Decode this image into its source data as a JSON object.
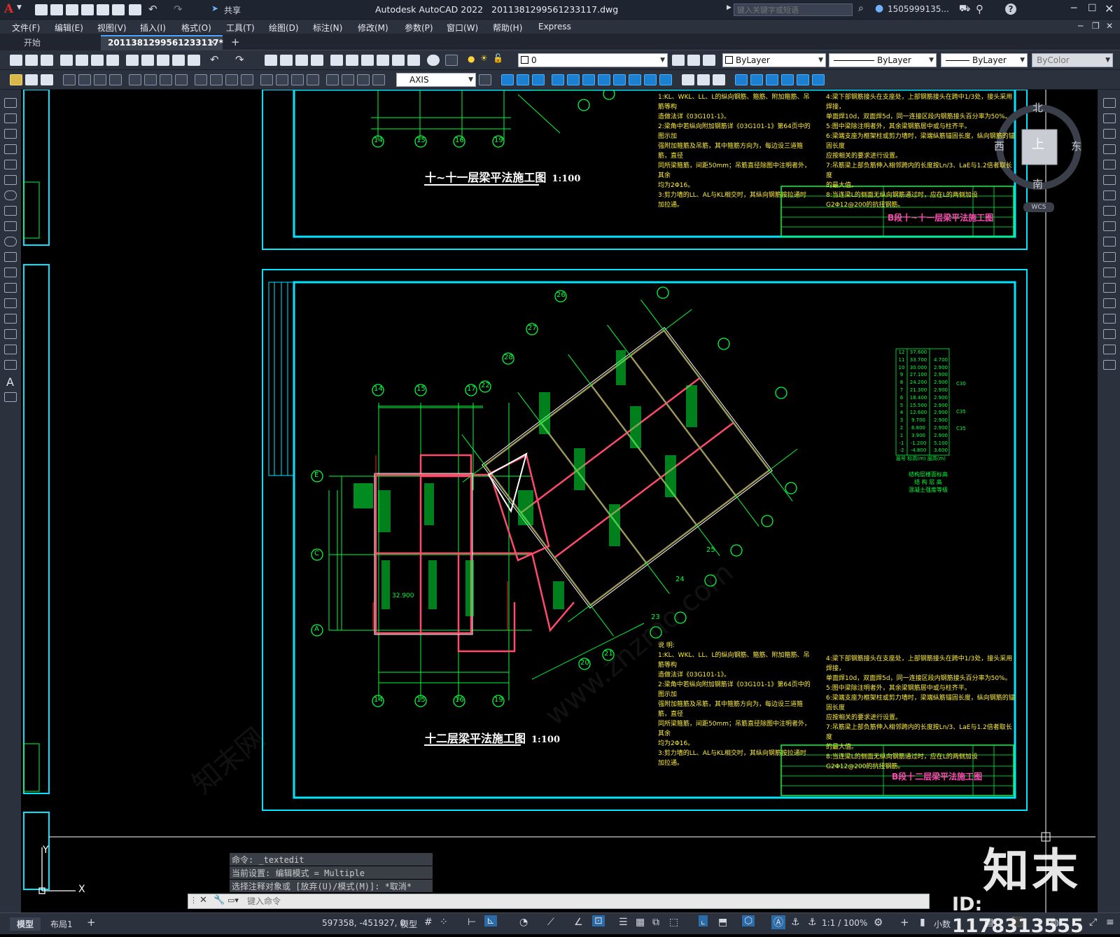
{
  "app": {
    "name": "Autodesk AutoCAD 2022",
    "file": "2011381299561233117.dwg",
    "share": "共享",
    "search_placeholder": "键入关键字或短语",
    "user": "1505999135...",
    "help": "?"
  },
  "menu": [
    "文件(F)",
    "编辑(E)",
    "视图(V)",
    "插入(I)",
    "格式(O)",
    "工具(T)",
    "绘图(D)",
    "标注(N)",
    "修改(M)",
    "参数(P)",
    "窗口(W)",
    "帮助(H)",
    "Express"
  ],
  "tabs": {
    "start": "开始",
    "active": "2011381299561233117*",
    "close": "×",
    "add": "+"
  },
  "toolbar": {
    "layer": "0",
    "color": "ByLayer",
    "linetype": "ByLayer",
    "lineweight": "ByLayer",
    "plotstyle": "ByColor",
    "textstyle": "AXIS"
  },
  "viewcube": {
    "north": "北",
    "south": "南",
    "east": "东",
    "west": "西",
    "top": "上",
    "wcs": "WCS"
  },
  "drawing": {
    "title_top": "十~十一层梁平法施工图",
    "scale_top": "1:100",
    "title_main": "十二层梁平法施工图",
    "scale_main": "1:100",
    "titleblock_top": "B段十~十一层梁平法施工图",
    "titleblock_main": "B段十二层梁平法施工图",
    "notes_head": "说 明:",
    "notes_left": [
      "1:KL、WKL、LL、L的纵向钢筋、箍筋、附加箍筋、吊筋等构",
      "  造做法详《03G101-1》。",
      "2:梁角中若纵向附加钢筋详《03G101-1》第64页中的图示加",
      "  强附加箍筋及吊筋，其中箍筋方向为，每边设三道箍筋，直径",
      "  同所梁箍筋，间距50mm；吊筋直径除图中注明者外，其余",
      "  均为2Φ16。",
      "3:剪力墙的LL、AL与KL相交时，其纵向钢筋按拉通时加拉通。"
    ],
    "notes_right": [
      "4:梁下部钢筋接头在支座处，上部钢筋接头在跨中1/3处，接头采用焊接，",
      "  单面焊10d，双面焊5d，同一连接区段内钢筋接头百分率为50%。",
      "5:图中梁除注明者外，其余梁钢筋居中或与柱齐平。",
      "6:梁端支座为框架柱或剪力墙时，梁端纵筋锚固长度，纵向钢筋的锚固长度",
      "  应按相关的要求进行设置。",
      "7:吊筋梁上部负筋伸入相邻跨内的长度按Ln/3、LaE与1.2倍者取长度",
      "  的最大值。",
      "8:当连梁L的侧面无纵向钢筋通过时，应在L的两侧加设",
      "  G2Φ12@200的抗扭钢筋。"
    ],
    "axis_top": [
      "14",
      "15",
      "16",
      "19"
    ],
    "axis_bottom": [
      "14",
      "15",
      "16",
      "19"
    ],
    "axis_main_top": [
      "14",
      "15",
      "17"
    ],
    "axis_rows": [
      "E",
      "C",
      "A"
    ],
    "axis_radial": [
      "26",
      "27",
      "28",
      "22",
      "23",
      "24",
      "25",
      "21",
      "20"
    ],
    "elev_label": "32.900",
    "legend_table": {
      "rows": [
        [
          "12",
          "37.600",
          ""
        ],
        [
          "11",
          "33.700",
          "4.700"
        ],
        [
          "10",
          "30.000",
          "2.900"
        ],
        [
          "9",
          "27.100",
          "2.900"
        ],
        [
          "8",
          "24.200",
          "2.900"
        ],
        [
          "7",
          "21.300",
          "2.900"
        ],
        [
          "6",
          "18.400",
          "2.900"
        ],
        [
          "5",
          "15.500",
          "2.900"
        ],
        [
          "4",
          "12.600",
          "2.900"
        ],
        [
          "3",
          "9.700",
          "2.900"
        ],
        [
          "2",
          "6.800",
          "2.900"
        ],
        [
          "1",
          "3.900",
          "2.900"
        ],
        [
          "-1",
          "-1.200",
          "5.100"
        ],
        [
          "-2",
          "-4.800",
          "3.600"
        ]
      ],
      "headers": [
        "层号",
        "标高(m)",
        "层高(m)"
      ],
      "notes": [
        "结构层楼面标高",
        "结 构 层 高",
        "混凝土强度等级"
      ],
      "grades": [
        "C30",
        "C35",
        "C35"
      ]
    }
  },
  "command": {
    "history": [
      "命令: _textedit",
      "当前设置: 编辑模式 = Multiple",
      "选择注释对象或 [放弃(U)/模式(M)]: *取消*"
    ],
    "placeholder": "键入命令"
  },
  "ucs": {
    "x": "X",
    "y": "Y"
  },
  "status": {
    "coords": "597358, -451927, 0",
    "model": "模型",
    "scale": "1:1 / 100%",
    "units": "小数",
    "layout_model": "模型",
    "layout1": "布局1",
    "add": "+"
  },
  "watermark": {
    "brand": "知末",
    "id": "ID: 1178313555",
    "site": "www.znzmo.com",
    "site2": "知末网"
  }
}
